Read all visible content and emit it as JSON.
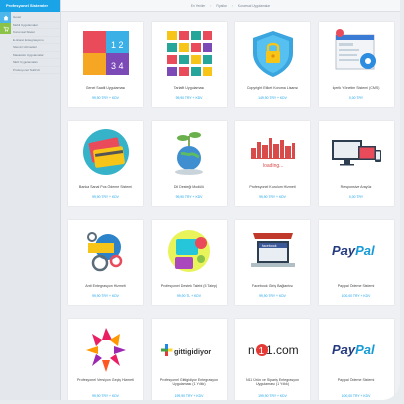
{
  "sidebar": {
    "title": "Profesyonel Sistemler",
    "items": [
      {
        "label": "Genel"
      },
      {
        "label": "Mobil Uygulamalar"
      },
      {
        "label": "Kurumsal Siteler"
      },
      {
        "label": "E-ticaret Entegrasyonu"
      },
      {
        "label": "Sitemiz Hizmetleri"
      },
      {
        "label": "Masaüstü Uygulamalar"
      },
      {
        "label": "SEO Uygulamaları"
      },
      {
        "label": "Profesyonel Teklif Al"
      }
    ]
  },
  "breadcrumb": {
    "items": [
      "En Yeniler",
      "Fiyatlar",
      "Kurumsal Uygulamalar"
    ]
  },
  "products": [
    {
      "name": "Genel Saatli Uygulaması",
      "price": "99,90 TRY + KDV",
      "icon": "numbers-tiles-icon"
    },
    {
      "name": "Tarlafit Uygulaması",
      "price": "99,90 TRY + KDV",
      "icon": "icons-grid-icon"
    },
    {
      "name": "Copyright Etiket Koruma Lisansı",
      "price": "149,90 TRY + KDV",
      "icon": "shield-lock-icon"
    },
    {
      "name": "İçerik Yönetim Sistemi (CMS)",
      "price": "0,00 TRY",
      "icon": "cms-settings-icon"
    },
    {
      "name": "Banka Sanal Pos Ödeme Sistemi",
      "price": "99,90 TRY + KDV",
      "icon": "credit-card-icon"
    },
    {
      "name": "Dil Desteği Modülü",
      "price": "99,90 TRY + KDV",
      "icon": "globe-plant-icon"
    },
    {
      "name": "Profesyonel Kurulum Hizmeti",
      "price": "99,90 TRY + KDV",
      "icon": "skyline-loading-icon"
    },
    {
      "name": "Responsive Arayüz",
      "price": "0,00 TRY",
      "icon": "responsive-devices-icon"
    },
    {
      "name": "Antt Entegrasyon Hizmeti",
      "price": "99,90 TRY + KDV",
      "icon": "gears-icon"
    },
    {
      "name": "Profesyonel Destek Talebi (5 Talep)",
      "price": "99,90 TL + KDV",
      "icon": "support-headset-icon"
    },
    {
      "name": "Facebook Giriş Bağlantısı",
      "price": "99,90 TRY + KDV",
      "icon": "facebook-laptop-icon"
    },
    {
      "name": "Paypal Ödeme Sistemi",
      "price": "100,00 TRY + KDV",
      "icon": "paypal-logo",
      "logo": "PayPal"
    },
    {
      "name": "Profesyonel Versiyon Geçiş Hizmeti",
      "price": "99,90 TRY + KDV",
      "icon": "arrows-burst-icon"
    },
    {
      "name": "Profesyonel Gittigidiyor Entegrasyon Uygulaması (1 Yıllık)",
      "price": "199,90 TRY + KDV",
      "icon": "gittigidiyor-logo",
      "logo": "gittigidiyor"
    },
    {
      "name": "N11 Ürün ve Sipariş Entegrasyon Uygulaması (1 Yıllık)",
      "price": "199,90 TRY + KDV",
      "icon": "n11-logo",
      "logo": "n11.com"
    },
    {
      "name": "Paypal Ödeme Sistemi",
      "price": "100,00 TRY + KDV",
      "icon": "paypal-logo",
      "logo": "PayPal"
    }
  ],
  "colors": {
    "accent": "#1ba3e8",
    "rail_blue": "#4db6ea",
    "rail_green": "#8bc34a",
    "paypal_dark": "#253b80",
    "paypal_light": "#179bd7"
  }
}
